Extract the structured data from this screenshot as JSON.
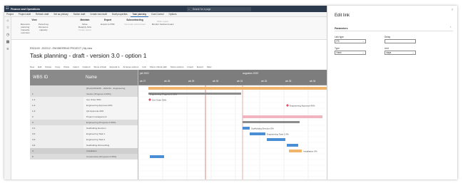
{
  "app": {
    "title": "Finance and Operations",
    "search_placeholder": "Search for a page"
  },
  "menu_tabs": [
    "Project",
    "Project draft",
    "Refresh draft",
    "Set as primary",
    "Switch draft",
    "Create new draft",
    "Draft properties",
    "Task planning",
    "Cost Control",
    "Options"
  ],
  "active_tab": "Task planning",
  "ribbon_groups": [
    {
      "title": "View",
      "items": [
        "Resource planning",
        "Capacity overview",
        "Period log",
        "Resource capacity"
      ]
    },
    {
      "title": "Maintain",
      "items": [
        "Move",
        "Reapply links",
        "Create action"
      ]
    },
    {
      "title": "Export",
      "items": [
        "Export to PDF"
      ]
    },
    {
      "title": "Subcontracting",
      "items": [
        "Generate subcontract"
      ]
    },
    {
      "title": "",
      "items": [
        "Work report",
        "Monitor Kanban board"
      ]
    }
  ],
  "nav_icons": [
    "home-icon",
    "star-icon",
    "clock-icon",
    "workspace-icon",
    "list-icon"
  ],
  "breadcrumb": "ES01100 : 2022/12 : ENGINEERING PROJECT | My view",
  "page_title": "Task planning - draft - version 3.0 - option 1",
  "toolbar": [
    "New",
    "Edit",
    "Delete",
    "Copy",
    "Paste",
    "Indent",
    "Outdent",
    "Show critical",
    "Expand to",
    "Arrange options",
    "Link",
    "Show critical path",
    "Show options",
    "Import",
    "Export",
    "Filter"
  ],
  "grid": {
    "col_wbs": "WBS ID",
    "col_name": "Name",
    "rows": [
      {
        "wbs": "",
        "name": "[Draft] 0001150 - 2022/12 - Engineering",
        "style": "sum"
      },
      {
        "wbs": "1",
        "name": "Vendor (Progress 0.00%)",
        "style": "sum"
      },
      {
        "wbs": "1.1",
        "name": "Get Order 50%",
        "style": ""
      },
      {
        "wbs": "1.2",
        "name": "Engineering Approval 40%",
        "style": ""
      },
      {
        "wbs": "1.3",
        "name": "QA Approval 40%",
        "style": ""
      },
      {
        "wbs": "2",
        "name": "Project management",
        "style": ""
      },
      {
        "wbs": "3",
        "name": "Engineering (Progress 0.00%)",
        "style": "sum"
      },
      {
        "wbs": "3.1",
        "name": "Scaffolding Erection",
        "style": ""
      },
      {
        "wbs": "3.2",
        "name": "Engineering Task 1",
        "style": ""
      },
      {
        "wbs": "3.3",
        "name": "Engineering Task 2",
        "style": ""
      },
      {
        "wbs": "3.4",
        "name": "Scaffolding Dismantling",
        "style": ""
      },
      {
        "wbs": "4",
        "name": "Installation",
        "style": "sel"
      },
      {
        "wbs": "5",
        "name": "Construction (Progress 0.00%)",
        "style": "sum"
      }
    ]
  },
  "gantt": {
    "months": [
      "juli 2022",
      "augustus 2022"
    ],
    "weeks": [
      "wk 27",
      "wk 28",
      "wk 29",
      "wk 30",
      "wk 31",
      "wk 32",
      "wk 33",
      "wk 34"
    ],
    "labels": [
      "Engineering Progress 0.00%",
      "Get Order 50%",
      "Engineering Approval 40%",
      "Scaffolding Erection 0%",
      "Engineering Task 1 0%",
      "Installation 0%"
    ],
    "colors": {
      "summary": "#8c8c8c",
      "task": "#4a8fd6",
      "milestone": "#e0506a",
      "pink": "#f2b5c0",
      "orange": "#f0b46a",
      "today": "#c0392b"
    }
  },
  "panel": {
    "title": "Edit link",
    "help": "?",
    "section": "Parameters",
    "fields": [
      {
        "label": "Link type",
        "value": "FS"
      },
      {
        "label": "Delay",
        "value": ""
      },
      {
        "label": "Type",
        "value": "Hard"
      },
      {
        "label": "Unit",
        "value": "days"
      }
    ]
  }
}
